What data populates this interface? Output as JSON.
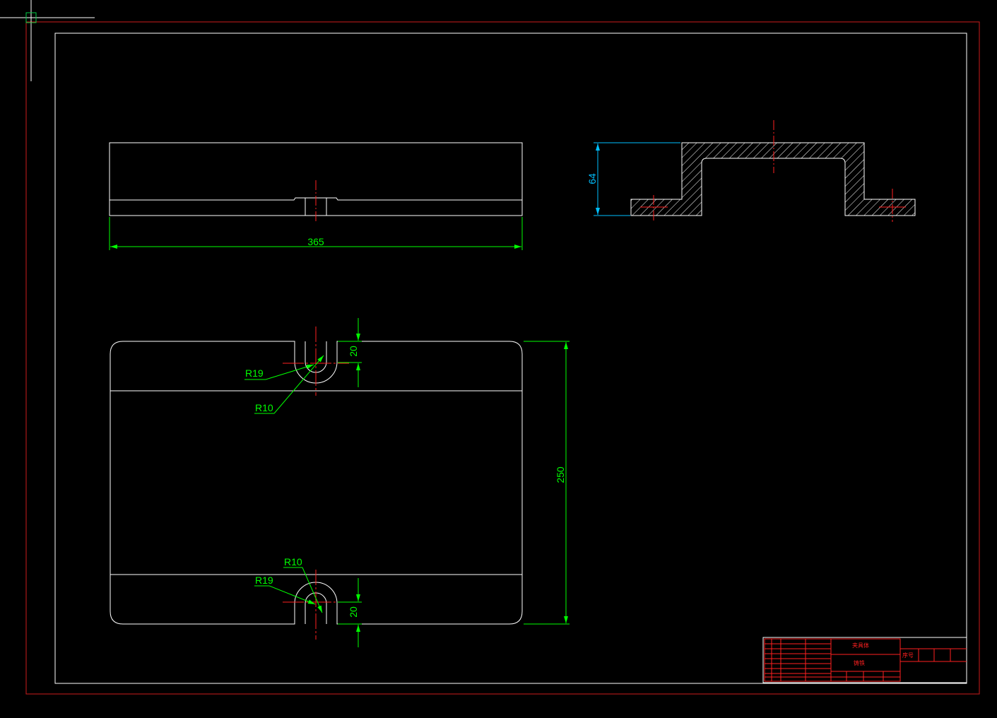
{
  "app": {
    "background_color": "#000000",
    "cursor": {
      "name": "crosshair-cursor",
      "color": "#ffffff",
      "pickbox_color": "#00cc44"
    }
  },
  "colors": {
    "outline": "#ffffff",
    "dimension": "#00ff00",
    "centerline": "#ff2020",
    "border_outer": "#cc1b1b",
    "border_inner": "#ffffff",
    "section_dimension": "#00bfff",
    "hatch": "#ffffff"
  },
  "drawing": {
    "front_view": {
      "width_dim": "365"
    },
    "section_view": {
      "height_dim": "64"
    },
    "plan_view": {
      "height_dim": "250",
      "top_slot": {
        "r_outer": "R19",
        "r_inner": "R10",
        "depth_dim": "20"
      },
      "bottom_slot": {
        "r_outer": "R19",
        "r_inner": "R10",
        "depth_dim": "20"
      }
    }
  },
  "title_block": {
    "part_name": "夹具体",
    "material": "铸铁",
    "seq_label": "序号"
  }
}
